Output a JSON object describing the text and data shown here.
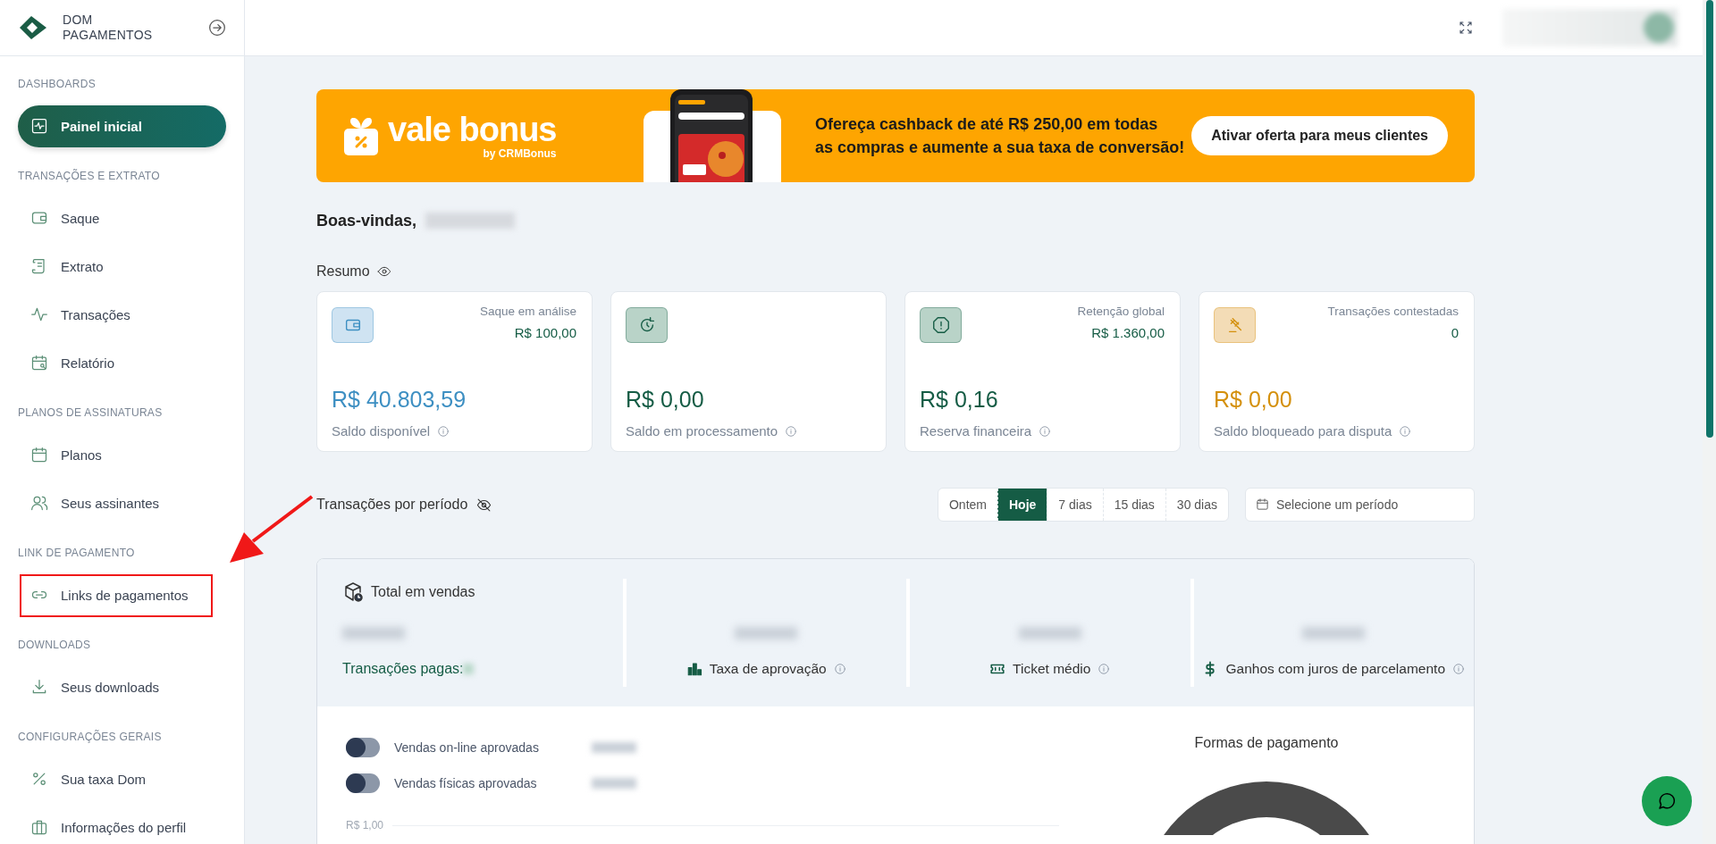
{
  "sidebar": {
    "brand": "DOM PAGAMENTOS",
    "sections": [
      {
        "title": "DASHBOARDS",
        "items": [
          {
            "label": "Painel inicial",
            "selected": true,
            "marked": false
          }
        ]
      },
      {
        "title": "TRANSAÇÕES E EXTRATO",
        "items": [
          {
            "label": "Saque",
            "selected": false,
            "marked": false
          },
          {
            "label": "Extrato",
            "selected": false,
            "marked": false
          },
          {
            "label": "Transações",
            "selected": false,
            "marked": false
          },
          {
            "label": "Relatório",
            "selected": false,
            "marked": false
          }
        ]
      },
      {
        "title": "PLANOS DE ASSINATURAS",
        "items": [
          {
            "label": "Planos",
            "selected": false,
            "marked": false
          },
          {
            "label": "Seus assinantes",
            "selected": false,
            "marked": false
          }
        ]
      },
      {
        "title": "LINK DE PAGAMENTO",
        "items": [
          {
            "label": "Links de pagamentos",
            "selected": false,
            "marked": true
          }
        ]
      },
      {
        "title": "DOWNLOADS",
        "items": [
          {
            "label": "Seus downloads",
            "selected": false,
            "marked": false
          }
        ]
      },
      {
        "title": "CONFIGURAÇÕES GERAIS",
        "items": [
          {
            "label": "Sua taxa Dom",
            "selected": false,
            "marked": false
          },
          {
            "label": "Informações do perfil",
            "selected": false,
            "marked": false
          }
        ]
      }
    ]
  },
  "banner": {
    "logo": "vale bonus",
    "logo_sub": "by CRMBonus",
    "lines": [
      "Ofereça cashback de até R$ 250,00 em todas",
      "as compras e aumente a sua taxa de conversão!"
    ],
    "button": "Ativar oferta para meus clientes"
  },
  "greeting": "Boas-vindas,",
  "summary": {
    "title": "Resumo",
    "cards": [
      {
        "kind": "available",
        "caption": "Saque em análise",
        "caption_value": "R$ 100,00",
        "amount": "R$ 40.803,59",
        "label": "Saldo disponível",
        "color": "#3d8fc2"
      },
      {
        "kind": "processing",
        "amount": "R$ 0,00",
        "label": "Saldo em processamento",
        "color": "#155c45"
      },
      {
        "kind": "reserve",
        "caption": "Retenção global",
        "caption_value": "R$ 1.360,00",
        "amount": "R$ 0,16",
        "label": "Reserva financeira",
        "color": "#155c45"
      },
      {
        "kind": "dispute",
        "caption": "Transações contestadas",
        "caption_value": "0",
        "amount": "R$ 0,00",
        "label": "Saldo bloqueado para disputa",
        "color": "#d4900c"
      }
    ]
  },
  "period": {
    "title": "Transações por período",
    "ranges": [
      {
        "label": "Ontem",
        "selected": false
      },
      {
        "label": "Hoje",
        "selected": true
      },
      {
        "label": "7 dias",
        "selected": false
      },
      {
        "label": "15 dias",
        "selected": false
      },
      {
        "label": "30 dias",
        "selected": false
      }
    ],
    "date_placeholder": "Selecione um período"
  },
  "sales": {
    "title": "Total em vendas",
    "paid_label": "Transações pagas:",
    "metrics": [
      {
        "kind": "approval",
        "label": "Taxa de aprovação"
      },
      {
        "kind": "ticket",
        "label": "Ticket médio"
      },
      {
        "kind": "interest",
        "label": "Ganhos com juros de parcelamento"
      }
    ]
  },
  "toggles": [
    {
      "label": "Vendas on-line aprovadas",
      "on": false
    },
    {
      "label": "Vendas físicas aprovadas",
      "on": false
    }
  ],
  "chart": {
    "y_label": "R$ 1,00",
    "donut_title": "Formas de pagamento"
  }
}
